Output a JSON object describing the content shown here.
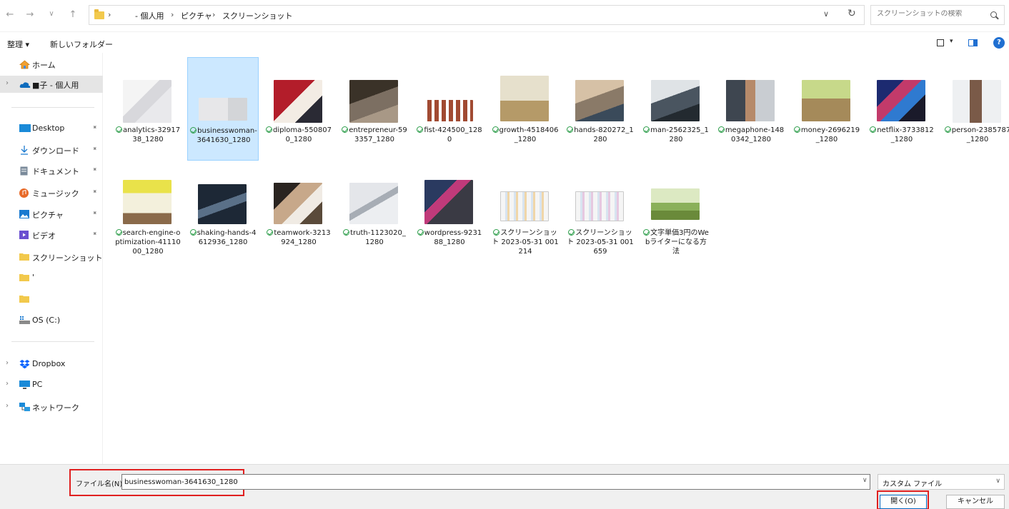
{
  "address_bar": {
    "back": "←",
    "forward": "→",
    "recent": "∨",
    "up": "↑",
    "crumbs": [
      "- 個人用",
      "ピクチャ",
      "スクリーンショット"
    ],
    "separator": "›",
    "dropdown": "∨",
    "refresh": "↻",
    "search_placeholder": "スクリーンショットの検索"
  },
  "toolbar": {
    "organize": "整理 ▾",
    "new_folder": "新しいフォルダー",
    "dropdown": "▾",
    "help": "?"
  },
  "sidebar": {
    "pin": "📌",
    "items": [
      {
        "label": "ホーム",
        "icon": "home-icon",
        "chevron": ""
      },
      {
        "label": "■子 - 個人用",
        "icon": "onedrive-cloud-icon",
        "chevron": "›"
      },
      {
        "label": "Desktop",
        "icon": "desktop-icon",
        "pinned": true
      },
      {
        "label": "ダウンロード",
        "icon": "download-icon",
        "pinned": true
      },
      {
        "label": "ドキュメント",
        "icon": "document-icon",
        "pinned": true
      },
      {
        "label": "ミュージック",
        "icon": "music-icon",
        "pinned": true
      },
      {
        "label": "ピクチャ",
        "icon": "pictures-icon",
        "pinned": true
      },
      {
        "label": "ビデオ",
        "icon": "video-icon",
        "pinned": true
      },
      {
        "label": "スクリーンショット",
        "icon": "folder-icon"
      },
      {
        "label": "'",
        "icon": "folder-icon"
      },
      {
        "label": "",
        "icon": "folder-icon"
      },
      {
        "label": "OS (C:)",
        "icon": "drive-icon"
      },
      {
        "label": "Dropbox",
        "icon": "dropbox-icon",
        "chevron": "›"
      },
      {
        "label": "PC",
        "icon": "pc-icon",
        "chevron": "›"
      },
      {
        "label": "ネットワーク",
        "icon": "network-icon",
        "chevron": "›"
      }
    ]
  },
  "files": [
    {
      "name": "analytics-3291738_1280"
    },
    {
      "name": "businesswoman-3641630_1280",
      "selected": true
    },
    {
      "name": "diploma-5508070_1280"
    },
    {
      "name": "entrepreneur-593357_1280"
    },
    {
      "name": "fist-424500_1280"
    },
    {
      "name": "growth-4518406_1280"
    },
    {
      "name": "hands-820272_1280"
    },
    {
      "name": "man-2562325_1280"
    },
    {
      "name": "megaphone-1480342_1280"
    },
    {
      "name": "money-2696219_1280"
    },
    {
      "name": "netflix-3733812_1280"
    },
    {
      "name": "person-2385787_1280"
    },
    {
      "name": "search-engine-optimization-4111000_1280"
    },
    {
      "name": "shaking-hands-4612936_1280"
    },
    {
      "name": "teamwork-3213924_1280"
    },
    {
      "name": "truth-1123020_1280"
    },
    {
      "name": "wordpress-923188_1280"
    },
    {
      "name": "スクリーンショット 2023-05-31 001214"
    },
    {
      "name": "スクリーンショット 2023-05-31 001659"
    },
    {
      "name": "文字単価3円のWebライターになる方法"
    }
  ],
  "footer": {
    "filename_label": "ファイル名(N):",
    "filename_value": "businesswoman-3641630_1280",
    "dropdown": "∨",
    "filetype": "カスタム ファイル",
    "open": "開く(O)",
    "cancel": "キャンセル"
  },
  "colors": {
    "selection_bg": "#cce8ff",
    "highlight_frame": "#e02020",
    "accent": "#0067c0"
  }
}
